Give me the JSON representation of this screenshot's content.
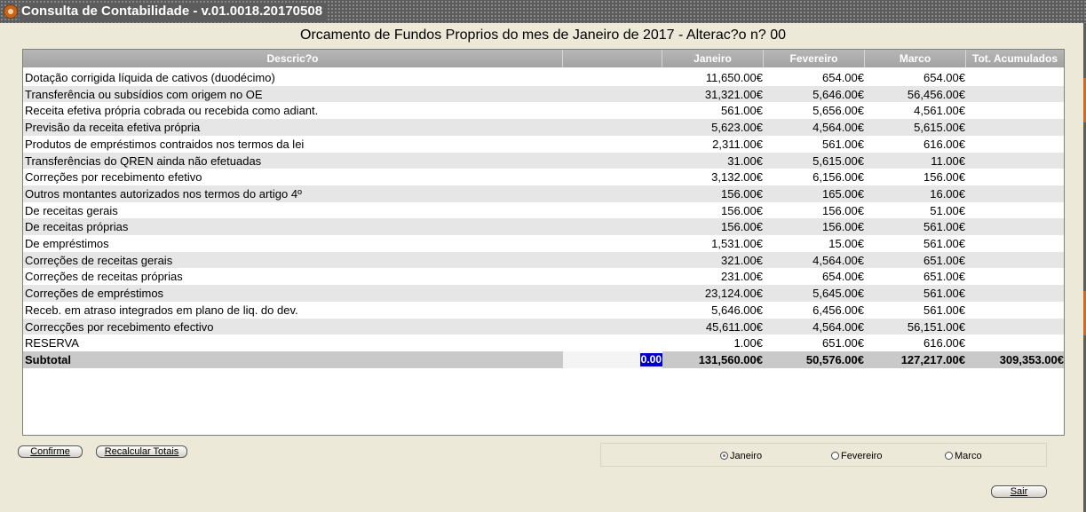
{
  "window": {
    "title": "Consulta de Contabilidade - v.01.0018.20170508"
  },
  "heading": "Orcamento de Fundos Proprios do mes de Janeiro de 2017 - Alterac?o n? 00",
  "columns": {
    "description": "Descric?o",
    "blank": "",
    "january": "Janeiro",
    "february": "Fevereiro",
    "march": "Marco",
    "total": "Tot. Acumulados"
  },
  "rows": [
    {
      "desc": "Dotação corrigida líquida de cativos (duodécimo)",
      "jan": "11,650.00€",
      "fev": "654.00€",
      "mar": "654.00€",
      "tot": ""
    },
    {
      "desc": "Transferência ou subsídios com origem no OE",
      "jan": "31,321.00€",
      "fev": "5,646.00€",
      "mar": "56,456.00€",
      "tot": ""
    },
    {
      "desc": "Receita efetiva própria cobrada ou recebida como adiant.",
      "jan": "561.00€",
      "fev": "5,656.00€",
      "mar": "4,561.00€",
      "tot": ""
    },
    {
      "desc": "Previsão da receita efetiva própria",
      "jan": "5,623.00€",
      "fev": "4,564.00€",
      "mar": "5,615.00€",
      "tot": ""
    },
    {
      "desc": "Produtos de empréstimos contraidos nos termos da lei",
      "jan": "2,311.00€",
      "fev": "561.00€",
      "mar": "616.00€",
      "tot": ""
    },
    {
      "desc": "Transferências do QREN ainda não efetuadas",
      "jan": "31.00€",
      "fev": "5,615.00€",
      "mar": "11.00€",
      "tot": ""
    },
    {
      "desc": "Correções por recebimento efetivo",
      "jan": "3,132.00€",
      "fev": "6,156.00€",
      "mar": "156.00€",
      "tot": ""
    },
    {
      "desc": "Outros montantes autorizados nos termos do artigo 4º",
      "jan": "156.00€",
      "fev": "165.00€",
      "mar": "16.00€",
      "tot": ""
    },
    {
      "desc": "De receitas gerais",
      "jan": "156.00€",
      "fev": "156.00€",
      "mar": "51.00€",
      "tot": ""
    },
    {
      "desc": "De receitas próprias",
      "jan": "156.00€",
      "fev": "156.00€",
      "mar": "561.00€",
      "tot": ""
    },
    {
      "desc": "De empréstimos",
      "jan": "1,531.00€",
      "fev": "15.00€",
      "mar": "561.00€",
      "tot": ""
    },
    {
      "desc": "Correções de receitas gerais",
      "jan": "321.00€",
      "fev": "4,564.00€",
      "mar": "651.00€",
      "tot": ""
    },
    {
      "desc": "Correções de receitas próprias",
      "jan": "231.00€",
      "fev": "654.00€",
      "mar": "651.00€",
      "tot": ""
    },
    {
      "desc": "Correções de empréstimos",
      "jan": "23,124.00€",
      "fev": "5,645.00€",
      "mar": "561.00€",
      "tot": ""
    },
    {
      "desc": "Receb. em atraso integrados em plano de liq. do dev.",
      "jan": "5,646.00€",
      "fev": "6,456.00€",
      "mar": "561.00€",
      "tot": ""
    },
    {
      "desc": "Correcções por recebimento efectivo",
      "jan": "45,611.00€",
      "fev": "4,564.00€",
      "mar": "56,151.00€",
      "tot": ""
    },
    {
      "desc": "RESERVA",
      "jan": "1.00€",
      "fev": "651.00€",
      "mar": "616.00€",
      "tot": ""
    }
  ],
  "subtotal": {
    "label": "Subtotal",
    "input_value": "0.00",
    "jan": "131,560.00€",
    "fev": "50,576.00€",
    "mar": "127,217.00€",
    "tot": "309,353.00€"
  },
  "buttons": {
    "confirm": "Confirme",
    "recalc": "Recalcular Totais",
    "exit": "Sair"
  },
  "radios": {
    "options": [
      "Janeiro",
      "Fevereiro",
      "Marco"
    ],
    "selected": "Janeiro"
  },
  "colors": {
    "window_bg": "#ece9d8",
    "header_bg": "#a8a8a8",
    "row_alt": "#e6e6e6",
    "subtotal_bg": "#c9c9c9",
    "selection": "#0000cc",
    "title_bar": "#5c5c5c"
  }
}
